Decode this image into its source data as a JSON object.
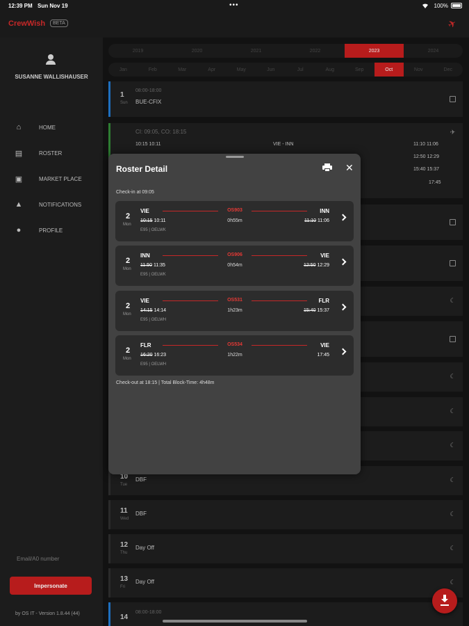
{
  "status": {
    "time": "12:39 PM",
    "date": "Sun Nov 19",
    "battery": "100%"
  },
  "app": {
    "name": "CrewWish",
    "badge": "BETA"
  },
  "sidebar": {
    "user": "SUSANNE WALLISHAUSER",
    "items": [
      {
        "label": "HOME",
        "icon": "home-icon"
      },
      {
        "label": "ROSTER",
        "icon": "roster-icon"
      },
      {
        "label": "MARKET PLACE",
        "icon": "market-icon"
      },
      {
        "label": "NOTIFICATIONS",
        "icon": "bell-icon"
      },
      {
        "label": "PROFILE",
        "icon": "person-icon"
      }
    ],
    "email_placeholder": "Email/A0 number",
    "impersonate": "Impersonate",
    "version": "by OS IT - Version 1.8.44 (44)"
  },
  "years": [
    "2019",
    "2020",
    "2021",
    "2022",
    "2023",
    "2024"
  ],
  "selected_year": "2023",
  "months": [
    "Jan",
    "Feb",
    "Mar",
    "Apr",
    "May",
    "Jun",
    "Jul",
    "Aug",
    "Sep",
    "Oct",
    "Nov",
    "Dec"
  ],
  "selected_month": "Oct",
  "days": [
    {
      "num": "1",
      "wd": "Sun",
      "title": "BUE-CFIX",
      "sub": "08:00-18:00"
    },
    {
      "num": "10",
      "wd": "Tue",
      "title": "DBF"
    },
    {
      "num": "11",
      "wd": "Wed",
      "title": "DBF"
    },
    {
      "num": "12",
      "wd": "Thu",
      "title": "Day Off"
    },
    {
      "num": "13",
      "wd": "Fri",
      "title": "Day Off"
    },
    {
      "num": "14",
      "wd": "",
      "title": "",
      "sub": "08:00-18:00"
    }
  ],
  "day2_preview": {
    "header": "CI: 09:05, CO: 18:15",
    "row1_times": "10:15 10:11",
    "row1_route": "VIE - INN",
    "row1_arr": "11:10 11:06",
    "col_right": [
      "12:50 12:29",
      "15:40 15:37",
      "17:45"
    ]
  },
  "modal": {
    "title": "Roster Detail",
    "checkin": "Check-in at 09:05",
    "checkout": "Check-out at 18:15 | Total Block-Time: 4h48m",
    "flights": [
      {
        "day": "2",
        "wd": "Mon",
        "from": "VIE",
        "to": "INN",
        "code": "OS903",
        "dep_sched": "10:15",
        "dep_act": "10:11",
        "duration": "0h55m",
        "arr_sched": "11:10",
        "arr_act": "11:06",
        "aircraft": "E95 | OELWK"
      },
      {
        "day": "2",
        "wd": "Mon",
        "from": "INN",
        "to": "VIE",
        "code": "OS906",
        "dep_sched": "11:50",
        "dep_act": "11:35",
        "duration": "0h54m",
        "arr_sched": "12:50",
        "arr_act": "12:29",
        "aircraft": "E95 | OELWK"
      },
      {
        "day": "2",
        "wd": "Mon",
        "from": "VIE",
        "to": "FLR",
        "code": "OS531",
        "dep_sched": "14:15",
        "dep_act": "14:14",
        "duration": "1h23m",
        "arr_sched": "15:40",
        "arr_act": "15:37",
        "aircraft": "E95 | OELWH"
      },
      {
        "day": "2",
        "wd": "Mon",
        "from": "FLR",
        "to": "VIE",
        "code": "OS534",
        "dep_sched": "16:20",
        "dep_act": "16:23",
        "duration": "1h22m",
        "arr_sched": "",
        "arr_act": "17:45",
        "aircraft": "E95 | OELWH"
      }
    ]
  }
}
